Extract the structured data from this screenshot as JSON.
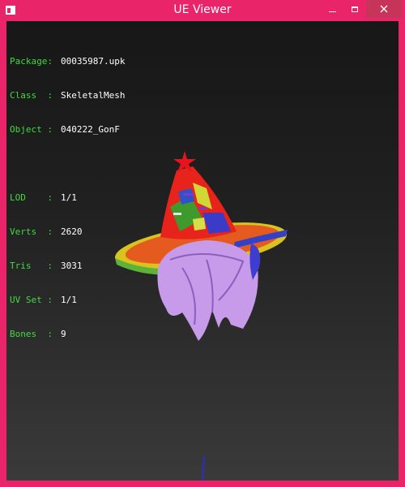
{
  "window": {
    "title": "UE Viewer"
  },
  "info": {
    "package": {
      "key": "Package:",
      "value": "00035987.upk"
    },
    "class": {
      "key": "Class  :",
      "value": "SkeletalMesh"
    },
    "object": {
      "key": "Object :",
      "value": "040222_GonF"
    },
    "lod": {
      "key": "LOD    :",
      "value": "1/1"
    },
    "verts": {
      "key": "Verts  :",
      "value": "2620"
    },
    "tris": {
      "key": "Tris   :",
      "value": "3031"
    },
    "uvset": {
      "key": "UV Set :",
      "value": "1/1"
    },
    "bones": {
      "key": "Bones  :",
      "value": "9"
    }
  },
  "colors": {
    "titlebar": "#ea2468",
    "label": "#3ddd3d",
    "value": "#ffffff",
    "hair": "#c79be9"
  },
  "icons": [
    "app-icon",
    "minimize-icon",
    "maximize-icon",
    "close-icon"
  ]
}
